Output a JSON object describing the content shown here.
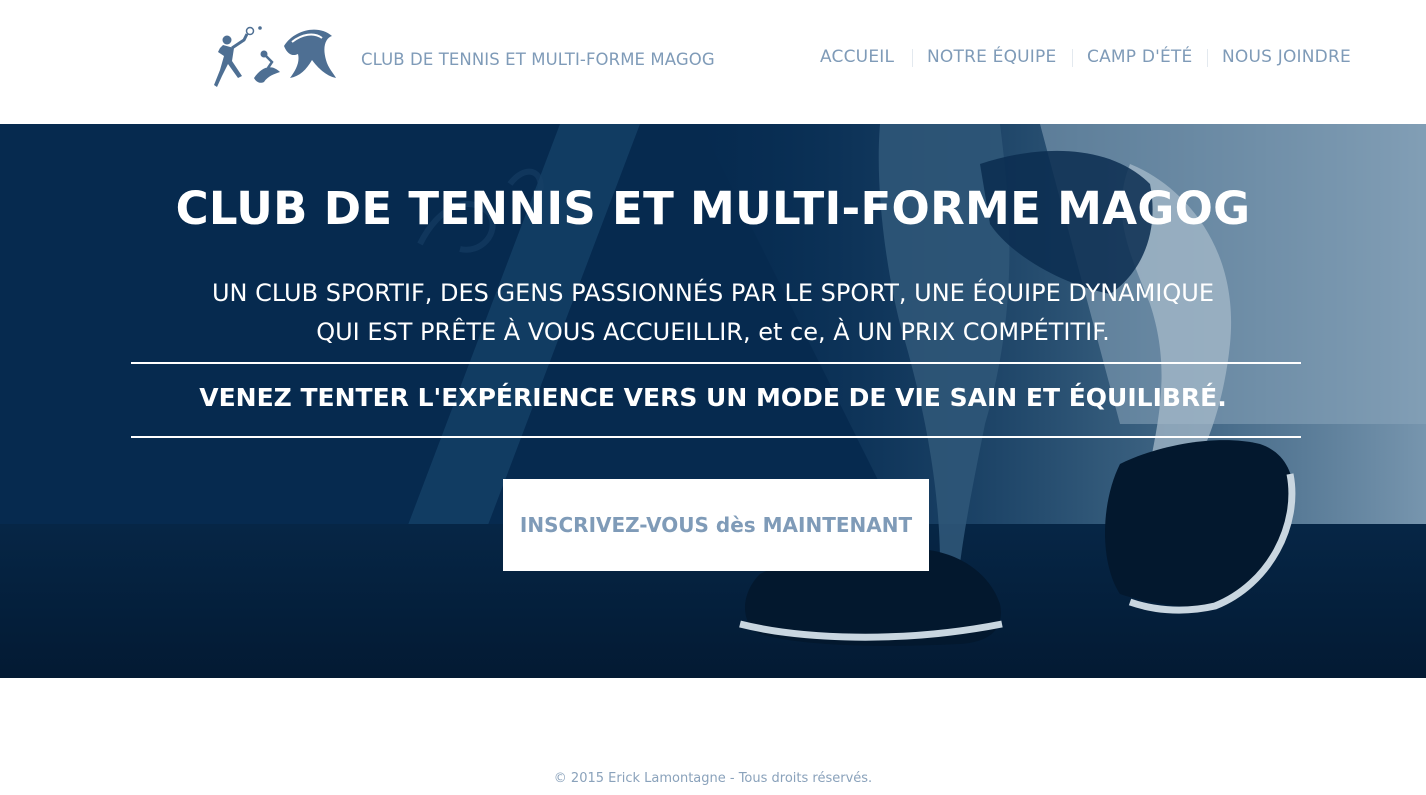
{
  "header": {
    "logo": {
      "icon": "tennis-players-logo-icon"
    },
    "brand_text": "CLUB DE TENNIS ET MULTI-FORME MAGOG",
    "nav": [
      {
        "label": "ACCUEIL"
      },
      {
        "label": "NOTRE ÉQUIPE"
      },
      {
        "label": "CAMP D'ÉTÉ"
      },
      {
        "label": "NOUS JOINDRE"
      }
    ]
  },
  "hero": {
    "title": "CLUB DE TENNIS ET MULTI-FORME MAGOG",
    "subtitle_line1": "UN CLUB SPORTIF, DES GENS PASSIONNÉS PAR LE SPORT, UNE ÉQUIPE DYNAMIQUE",
    "subtitle_line2": "QUI EST PRÊTE À VOUS ACCUEILLIR, et ce, À UN PRIX COMPÉTITIF.",
    "tagline": "VENEZ TENTER L'EXPÉRIENCE VERS UN MODE DE VIE SAIN ET ÉQUILIBRÉ.",
    "cta_label": "INSCRIVEZ-VOUS dès MAINTENANT",
    "background": "running-shoes-photo"
  },
  "footer": {
    "copyright": "© 2015 Erick Lamontagne - Tous droits réservés."
  },
  "colors": {
    "accent": "#7f9bb8",
    "hero_bg": "#062a4f",
    "white": "#ffffff"
  }
}
